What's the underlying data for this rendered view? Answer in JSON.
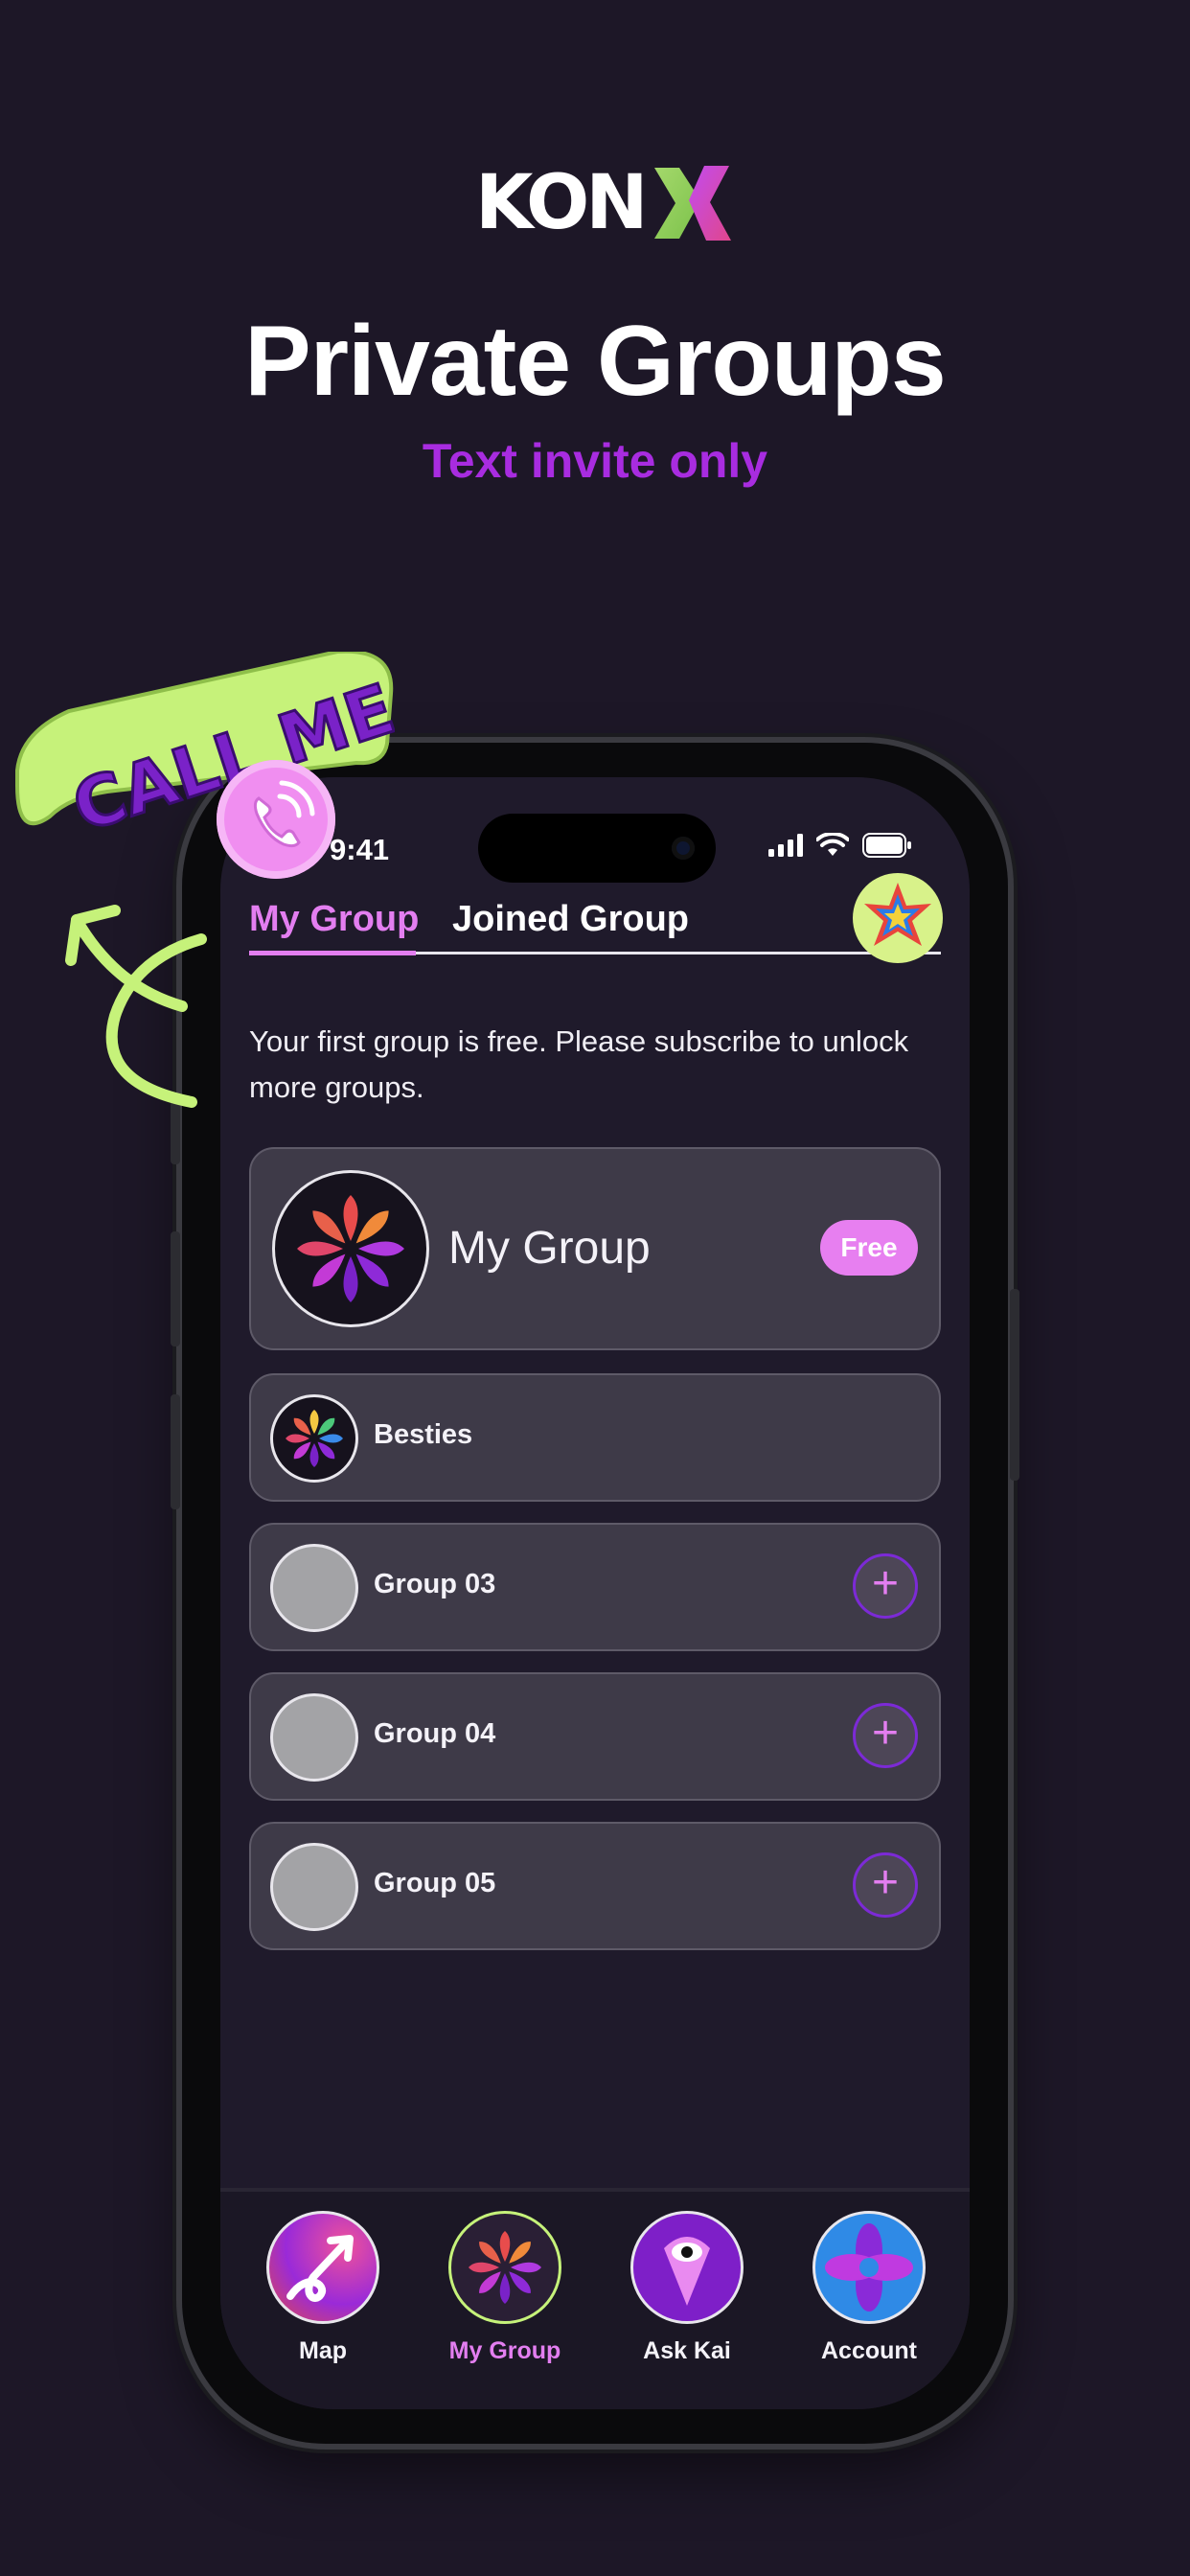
{
  "logo": {
    "text": "KON",
    "brand_colors": [
      "#a4d86b",
      "#a82ce0",
      "#e85aa8"
    ]
  },
  "headline": "Private Groups",
  "subheadline": "Text invite only",
  "sticker": {
    "text": "CALL ME"
  },
  "status_bar": {
    "time": "9:41"
  },
  "tabs": [
    {
      "label": "My Group",
      "active": true
    },
    {
      "label": "Joined Group",
      "active": false
    }
  ],
  "notice": "Your first group is free. Please subscribe to unlock more groups.",
  "groups": [
    {
      "name": "My Group",
      "badge": "Free",
      "icon": "flower-logo-icon"
    },
    {
      "name": "Besties",
      "icon": "flower-logo-icon"
    },
    {
      "name": "Group 03",
      "icon": "placeholder",
      "action": "add-icon"
    },
    {
      "name": "Group 04",
      "icon": "placeholder",
      "action": "add-icon"
    },
    {
      "name": "Group 05",
      "icon": "placeholder",
      "action": "add-icon"
    }
  ],
  "bottom_nav": [
    {
      "label": "Map",
      "icon": "map-arrow-icon",
      "active": false
    },
    {
      "label": "My Group",
      "icon": "flower-logo-icon",
      "active": true
    },
    {
      "label": "Ask Kai",
      "icon": "eye-pin-icon",
      "active": false
    },
    {
      "label": "Account",
      "icon": "flower-account-icon",
      "active": false
    }
  ],
  "colors": {
    "background": "#1d1727",
    "accent_pink": "#e37ef0",
    "accent_purple": "#a82ce0",
    "card": "#3e3a48",
    "sticker_green": "#c6f27a"
  }
}
